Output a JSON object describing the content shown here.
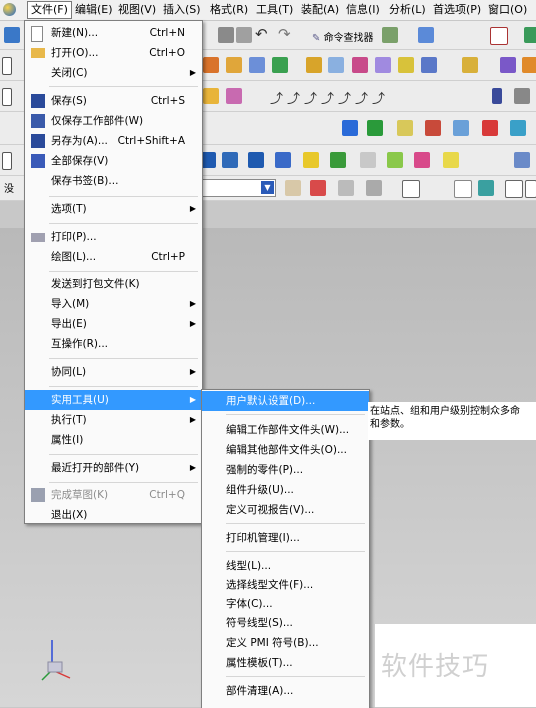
{
  "menubar": {
    "items": [
      "文件(F)",
      "编辑(E)",
      "视图(V)",
      "插入(S)",
      "格式(R)",
      "工具(T)",
      "装配(A)",
      "信息(I)",
      "分析(L)",
      "首选项(P)",
      "窗口(O)"
    ]
  },
  "toolbar": {
    "command_finder": "命令查找器",
    "filter_prefix": "没"
  },
  "file_menu": {
    "items": [
      {
        "label": "新建(N)...",
        "shortcut": "Ctrl+N",
        "icon": "new-file-icon"
      },
      {
        "label": "打开(O)...",
        "shortcut": "Ctrl+O",
        "icon": "open-folder-icon"
      },
      {
        "label": "关闭(C)",
        "shortcut": ""
      },
      {
        "label": "保存(S)",
        "shortcut": "Ctrl+S",
        "icon": "save-icon"
      },
      {
        "label": "仅保存工作部件(W)",
        "shortcut": "",
        "icon": "save-work-part-icon"
      },
      {
        "label": "另存为(A)...",
        "shortcut": "Ctrl+Shift+A",
        "icon": "save-as-icon"
      },
      {
        "label": "全部保存(V)",
        "shortcut": "",
        "icon": "save-all-icon"
      },
      {
        "label": "保存书签(B)...",
        "shortcut": ""
      },
      {
        "label": "选项(T)",
        "shortcut": ""
      },
      {
        "label": "打印(P)...",
        "shortcut": "",
        "icon": "print-icon"
      },
      {
        "label": "绘图(L)...",
        "shortcut": "Ctrl+P"
      },
      {
        "label": "发送到打包文件(K)",
        "shortcut": ""
      },
      {
        "label": "导入(M)",
        "shortcut": ""
      },
      {
        "label": "导出(E)",
        "shortcut": ""
      },
      {
        "label": "互操作(R)...",
        "shortcut": ""
      },
      {
        "label": "协同(L)",
        "shortcut": ""
      },
      {
        "label": "实用工具(U)",
        "shortcut": ""
      },
      {
        "label": "执行(T)",
        "shortcut": ""
      },
      {
        "label": "属性(I)",
        "shortcut": ""
      },
      {
        "label": "最近打开的部件(Y)",
        "shortcut": ""
      },
      {
        "label": "完成草图(K)",
        "shortcut": "Ctrl+Q",
        "icon": "finish-sketch-icon"
      },
      {
        "label": "退出(X)",
        "shortcut": ""
      }
    ]
  },
  "utilities_menu": {
    "items": [
      {
        "label": "用户默认设置(D)..."
      },
      {
        "label": "编辑工作部件文件头(W)..."
      },
      {
        "label": "编辑其他部件文件头(O)..."
      },
      {
        "label": "强制的零件(P)..."
      },
      {
        "label": "组件升级(U)..."
      },
      {
        "label": "定义可视报告(V)..."
      },
      {
        "label": "打印机管理(I)..."
      },
      {
        "label": "线型(L)..."
      },
      {
        "label": "选择线型文件(F)..."
      },
      {
        "label": "字体(C)..."
      },
      {
        "label": "符号线型(S)..."
      },
      {
        "label": "定义 PMI 符号(B)..."
      },
      {
        "label": "属性模板(T)..."
      },
      {
        "label": "部件清理(A)..."
      }
    ]
  },
  "tooltip": {
    "line1": "在站点、组和用户级别控制众多命",
    "line2": "和参数。"
  },
  "watermark": "软件技巧"
}
